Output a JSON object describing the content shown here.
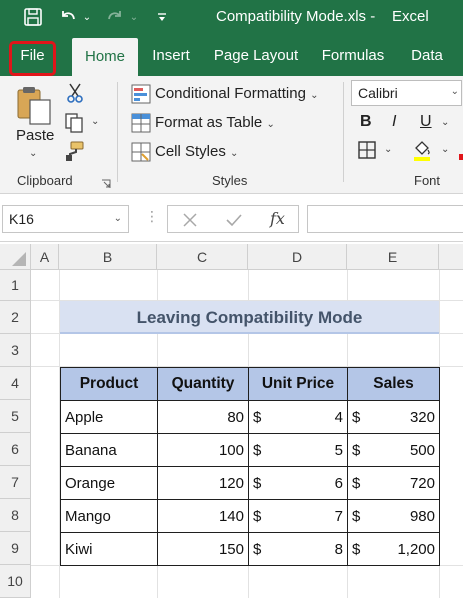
{
  "titlebar": {
    "document_title": "Compatibility Mode.xls",
    "separator": "-",
    "app_name": "Excel",
    "icons": [
      "save-icon",
      "undo-icon",
      "redo-icon",
      "customize-quick-access-icon"
    ]
  },
  "tabs": [
    {
      "label": "File",
      "highlighted": true
    },
    {
      "label": "Home",
      "active": true
    },
    {
      "label": "Insert"
    },
    {
      "label": "Page Layout"
    },
    {
      "label": "Formulas"
    },
    {
      "label": "Data"
    }
  ],
  "ribbon": {
    "clipboard": {
      "group_label": "Clipboard",
      "paste_label": "Paste"
    },
    "styles": {
      "group_label": "Styles",
      "conditional_formatting": "Conditional Formatting",
      "format_as_table": "Format as Table",
      "cell_styles": "Cell Styles"
    },
    "font": {
      "group_label": "Font",
      "font_name": "Calibri",
      "bold": "B",
      "italic": "I",
      "underline": "U"
    }
  },
  "formula_bar": {
    "name_box": "K16",
    "fx_label": "fx",
    "formula": ""
  },
  "grid": {
    "columns": [
      "A",
      "B",
      "C",
      "D",
      "E"
    ],
    "rows": [
      "1",
      "2",
      "3",
      "4",
      "5",
      "6",
      "7",
      "8",
      "9",
      "10"
    ],
    "title": "Leaving Compatibility Mode",
    "headers": {
      "product": "Product",
      "quantity": "Quantity",
      "unit_price": "Unit Price",
      "sales": "Sales"
    },
    "currency_symbol": "$",
    "records": [
      {
        "product": "Apple",
        "quantity": "80",
        "unit_price": "4",
        "sales": "320"
      },
      {
        "product": "Banana",
        "quantity": "100",
        "unit_price": "5",
        "sales": "500"
      },
      {
        "product": "Orange",
        "quantity": "120",
        "unit_price": "6",
        "sales": "720"
      },
      {
        "product": "Mango",
        "quantity": "140",
        "unit_price": "7",
        "sales": "980"
      },
      {
        "product": "Kiwi",
        "quantity": "150",
        "unit_price": "8",
        "sales": "1,200"
      }
    ]
  },
  "colors": {
    "excel_green": "#217346",
    "ribbon_bg": "#f3f3f3",
    "file_highlight": "#e0151a",
    "title_fill": "#d9e1f2",
    "header_fill": "#b4c6e7"
  }
}
